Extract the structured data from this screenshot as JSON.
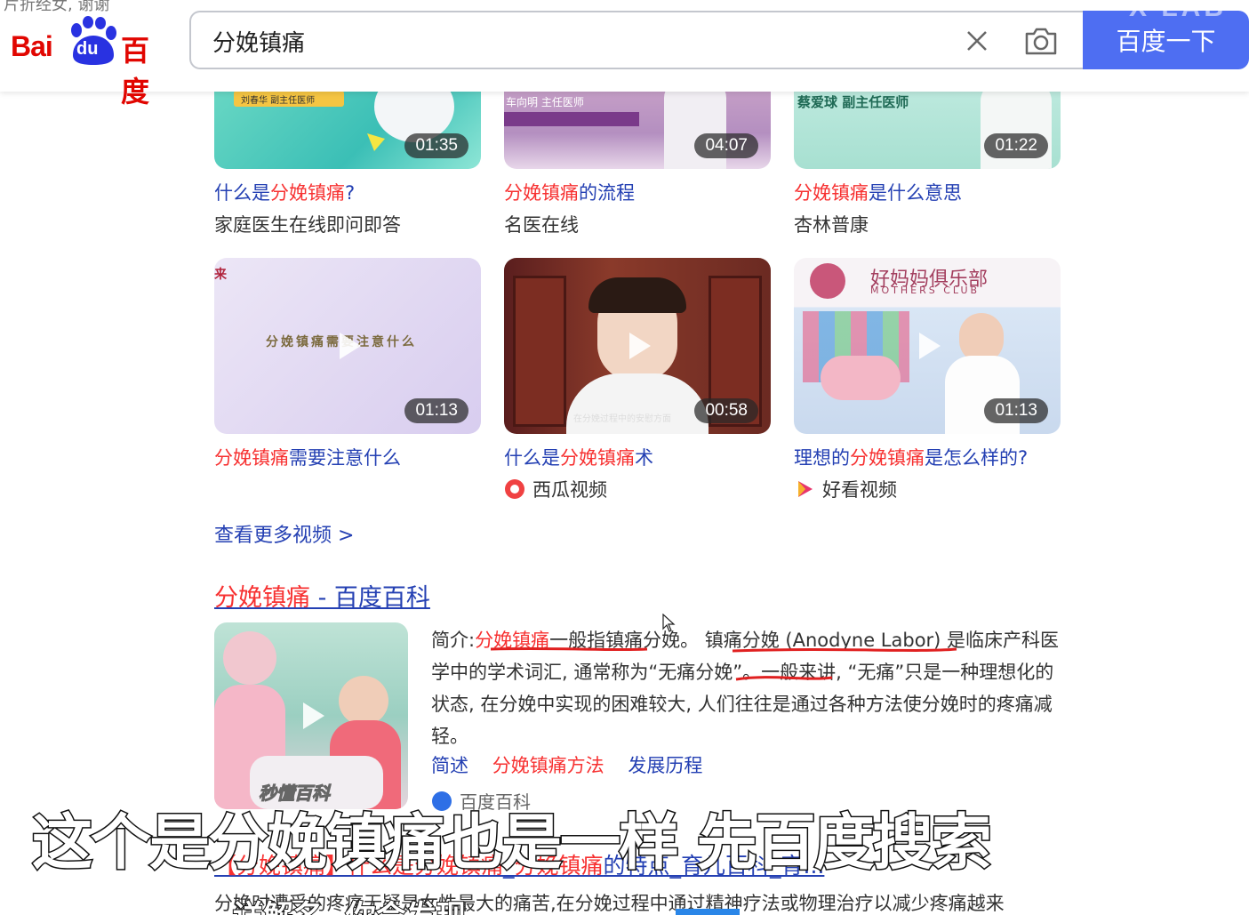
{
  "header": {
    "top_cut_text": "片折经女, 谢谢",
    "logo": {
      "text_latin": "Bai",
      "text_du": "du",
      "text_cn": "百度"
    },
    "search": {
      "value": "分娩镇痛",
      "placeholder": ""
    },
    "search_button": "百度一下",
    "watermark": "X LAB"
  },
  "videos": [
    {
      "title_pre": "什么是",
      "title_hl": "分娩镇痛",
      "title_post": "?",
      "source": "家庭医生在线即问即答",
      "duration": "01:35",
      "thumb_caption": "刘春华 副主任医师"
    },
    {
      "title_pre": "",
      "title_hl": "分娩镇痛",
      "title_post": "的流程",
      "source": "名医在线",
      "duration": "04:07",
      "thumb_caption": "车向明 主任医师"
    },
    {
      "title_pre": "",
      "title_hl": "分娩镇痛",
      "title_post": "是什么意思",
      "source": "杏林普康",
      "duration": "01:22",
      "thumb_caption": "蔡爱球 副主任医师"
    },
    {
      "title_pre": "",
      "title_hl": "分娩镇痛",
      "title_post": "需要注意什么",
      "source": "",
      "duration": "01:13",
      "thumb_caption": "分娩镇痛需要注意什么"
    },
    {
      "title_pre": "什么是",
      "title_hl": "分娩镇痛",
      "title_post": "术",
      "source": "西瓜视频",
      "duration": "00:58",
      "thumb_caption": "在分娩过程中的安慰方面"
    },
    {
      "title_pre": "理想的",
      "title_hl": "分娩镇痛",
      "title_post": "是怎么样的?",
      "source": "好看视频",
      "duration": "01:13",
      "thumb_caption": "好妈妈俱乐部"
    }
  ],
  "thumb_extra": {
    "mothers_club_en": "MOTHERS CLUB"
  },
  "more_videos": "查看更多视频 >",
  "baike": {
    "title_hl": "分娩镇痛",
    "title_rest": " - 百度百科",
    "intro_label": "简介:",
    "intro_hl": "分娩镇痛",
    "intro_text": "一般指镇痛分娩。 镇痛分娩 (Anodyne Labor) 是临床产科医学中的学术词汇, 通常称为“无痛分娩”。一般来讲, “无痛”只是一种理想化的状态, 在分娩中实现的困难较大, 人们往往是通过各种方法使分娩时的疼痛减轻。",
    "links": {
      "a": "简述",
      "b": "分娩镇痛方法",
      "c": "发展历程"
    },
    "source": "百度百科",
    "thumb_watermark": "秒懂百科"
  },
  "next_result": {
    "title_a": "【分娩镇痛】什么是",
    "title_b": "分娩镇痛",
    "title_c": "_",
    "title_d": "分娩镇痛",
    "title_e": "的特点_育儿百科_育...",
    "snippet": "分娩时遭受的疼痛无疑是女性最大的痛苦,在分娩过程中通过精神疗法或物理治疗以减少疼痛越来"
  },
  "overlay": {
    "subtitle": "这个是分娩镇痛也是一样 先百度搜索",
    "bottom_subtitle": "详解名, 你会发现"
  }
}
